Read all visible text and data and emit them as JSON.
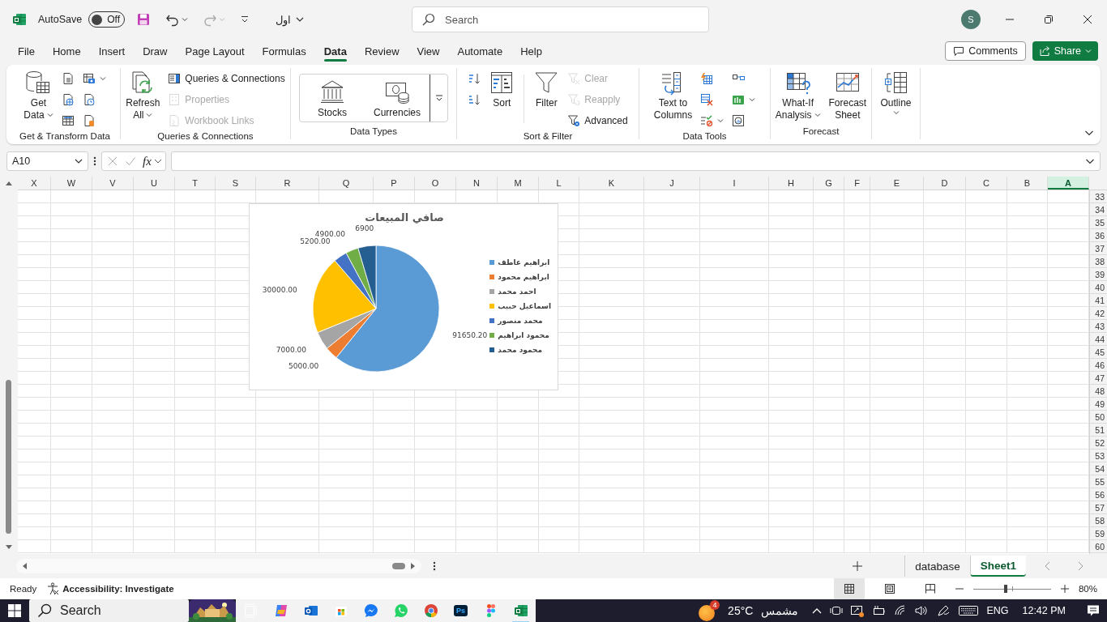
{
  "title_bar": {
    "autosave_label": "AutoSave",
    "autosave_on": false,
    "autosave_state": "Off",
    "file_name": "اول",
    "search_placeholder": "Search",
    "account_initial": "S"
  },
  "menu_tabs": [
    {
      "label": "File",
      "selected": false
    },
    {
      "label": "Home",
      "selected": false
    },
    {
      "label": "Insert",
      "selected": false
    },
    {
      "label": "Draw",
      "selected": false
    },
    {
      "label": "Page Layout",
      "selected": false
    },
    {
      "label": "Formulas",
      "selected": false
    },
    {
      "label": "Data",
      "selected": true
    },
    {
      "label": "Review",
      "selected": false
    },
    {
      "label": "View",
      "selected": false
    },
    {
      "label": "Automate",
      "selected": false
    },
    {
      "label": "Help",
      "selected": false
    }
  ],
  "comments_button": "Comments",
  "share_button": "Share",
  "ribbon_groups": [
    {
      "label": "Get & Transform Data",
      "items": [
        {
          "kind": "large",
          "lines": [
            "Get",
            "Data"
          ],
          "dropdown": true
        },
        {
          "kind": "stack",
          "buttons": [
            {
              "kind": "icon",
              "dropdown": false,
              "disabled": false
            },
            {
              "kind": "icon",
              "dropdown": false,
              "disabled": false
            },
            {
              "kind": "icon",
              "dropdown": false,
              "disabled": false
            }
          ]
        },
        {
          "kind": "stack",
          "buttons": [
            {
              "kind": "icon",
              "dropdown": true,
              "disabled": false
            },
            {
              "kind": "icon",
              "dropdown": false,
              "disabled": false
            },
            {
              "kind": "icon",
              "dropdown": false,
              "disabled": false
            }
          ]
        }
      ]
    },
    {
      "label": "Queries & Connections",
      "items": [
        {
          "kind": "large",
          "lines": [
            "Refresh",
            "All"
          ],
          "dropdown": true
        },
        {
          "kind": "stack",
          "buttons": [
            {
              "kind": "small",
              "label": "Queries & Connections",
              "dropdown": false,
              "disabled": false
            },
            {
              "kind": "small",
              "label": "Properties",
              "dropdown": false,
              "disabled": true
            },
            {
              "kind": "small",
              "label": "Workbook Links",
              "dropdown": false,
              "disabled": true
            }
          ]
        }
      ]
    },
    {
      "label": "Data Types",
      "items": [
        {
          "kind": "gallery",
          "options": [
            "Stocks",
            "Currencies"
          ]
        }
      ]
    },
    {
      "label": "Sort & Filter",
      "items": [
        {
          "kind": "stack",
          "buttons": [
            {
              "kind": "icon",
              "dropdown": false,
              "disabled": false
            },
            {
              "kind": "icon",
              "dropdown": false,
              "disabled": false
            }
          ]
        },
        {
          "kind": "large",
          "lines": [
            "Sort"
          ],
          "dropdown": false
        },
        {
          "kind": "large",
          "lines": [
            "Filter"
          ],
          "dropdown": false
        },
        {
          "kind": "stack",
          "buttons": [
            {
              "kind": "small",
              "label": "Clear",
              "dropdown": false,
              "disabled": true
            },
            {
              "kind": "small",
              "label": "Reapply",
              "dropdown": false,
              "disabled": true
            },
            {
              "kind": "small",
              "label": "Advanced",
              "dropdown": false,
              "disabled": false
            }
          ]
        }
      ]
    },
    {
      "label": "Data Tools",
      "items": [
        {
          "kind": "large",
          "lines": [
            "Text to",
            "Columns"
          ],
          "dropdown": false
        },
        {
          "kind": "stack",
          "buttons": [
            {
              "kind": "icon",
              "dropdown": false,
              "disabled": false
            },
            {
              "kind": "icon",
              "dropdown": false,
              "disabled": false
            },
            {
              "kind": "icon",
              "dropdown": true,
              "disabled": false
            }
          ]
        },
        {
          "kind": "stack",
          "buttons": [
            {
              "kind": "icon",
              "dropdown": false,
              "disabled": false
            },
            {
              "kind": "icon",
              "dropdown": true,
              "disabled": false
            },
            {
              "kind": "icon",
              "dropdown": false,
              "disabled": false
            }
          ]
        }
      ]
    },
    {
      "label": "Forecast",
      "items": [
        {
          "kind": "large",
          "lines": [
            "What-If",
            "Analysis"
          ],
          "dropdown": true
        },
        {
          "kind": "large",
          "lines": [
            "Forecast",
            "Sheet"
          ],
          "dropdown": false
        }
      ]
    },
    {
      "items": [
        {
          "kind": "large",
          "lines": [
            "Outline"
          ],
          "dropdown": true
        }
      ]
    }
  ],
  "formula_bar": {
    "name_box": "A10",
    "function_button": "fx"
  },
  "sheet": {
    "columns": [
      {
        "label": "X",
        "selected": false
      },
      {
        "label": "W",
        "selected": false
      },
      {
        "label": "V",
        "selected": false
      },
      {
        "label": "U",
        "selected": false
      },
      {
        "label": "T",
        "selected": false
      },
      {
        "label": "S",
        "selected": false
      },
      {
        "label": "R",
        "selected": false
      },
      {
        "label": "Q",
        "selected": false
      },
      {
        "label": "P",
        "selected": false
      },
      {
        "label": "O",
        "selected": false
      },
      {
        "label": "N",
        "selected": false
      },
      {
        "label": "M",
        "selected": false
      },
      {
        "label": "L",
        "selected": false
      },
      {
        "label": "K",
        "selected": false
      },
      {
        "label": "J",
        "selected": false
      },
      {
        "label": "I",
        "selected": false
      },
      {
        "label": "H",
        "selected": false
      },
      {
        "label": "G",
        "selected": false
      },
      {
        "label": "F",
        "selected": false
      },
      {
        "label": "E",
        "selected": false
      },
      {
        "label": "D",
        "selected": false
      },
      {
        "label": "C",
        "selected": false
      },
      {
        "label": "B",
        "selected": false
      },
      {
        "label": "A",
        "selected": true
      }
    ],
    "rows": [
      "33",
      "34",
      "35",
      "36",
      "37",
      "38",
      "39",
      "40",
      "41",
      "42",
      "43",
      "44",
      "45",
      "46",
      "47",
      "48",
      "49",
      "50",
      "51",
      "52",
      "53",
      "54",
      "55",
      "56",
      "57",
      "58",
      "59",
      "60"
    ],
    "chart_data": {
      "type": "pie",
      "title": "صافي المبيعات",
      "categories": [
        "ابراهيم عاطف",
        "ابراهيم محمود",
        "احمد محمد",
        "اسماعيل حبيب",
        "محمد منصور",
        "محمود ابراهيم",
        "محمود محمد"
      ],
      "values": [
        91650.2,
        5000,
        7000,
        30000,
        5200,
        4900,
        6900
      ],
      "value_labels": [
        "91650.20",
        "5000.00",
        "7000.00",
        "30000.00",
        "5200.00",
        "4900.00",
        "6900"
      ],
      "legend": "right"
    }
  },
  "sheet_tabs": [
    {
      "label": "database",
      "selected": false
    },
    {
      "label": "Sheet1",
      "selected": true
    }
  ],
  "status_bar": {
    "mode": "Ready",
    "accessibility": "Accessibility: Investigate",
    "views": [
      {
        "selected": true
      },
      {
        "selected": false
      },
      {
        "selected": false
      }
    ],
    "zoom": {
      "level": 0.42,
      "reading": "80%"
    }
  },
  "taskbar": {
    "search_placeholder": "Search",
    "apps": [
      {
        "kind": "taskview",
        "active": false
      },
      {
        "kind": "copilot",
        "active": false
      },
      {
        "kind": "outlook",
        "active": false
      },
      {
        "kind": "store",
        "active": false
      },
      {
        "kind": "messenger",
        "active": false
      },
      {
        "kind": "whatsapp",
        "active": false
      },
      {
        "kind": "chrome",
        "active": false
      },
      {
        "kind": "photoshop",
        "label": "Ps",
        "active": false
      },
      {
        "kind": "figma",
        "active": false
      },
      {
        "kind": "excel",
        "active": true
      }
    ],
    "weather": {
      "badge": "4",
      "temperature": "25°C",
      "condition": "مشمس"
    },
    "language": "ENG",
    "time": "12:42 PM"
  }
}
